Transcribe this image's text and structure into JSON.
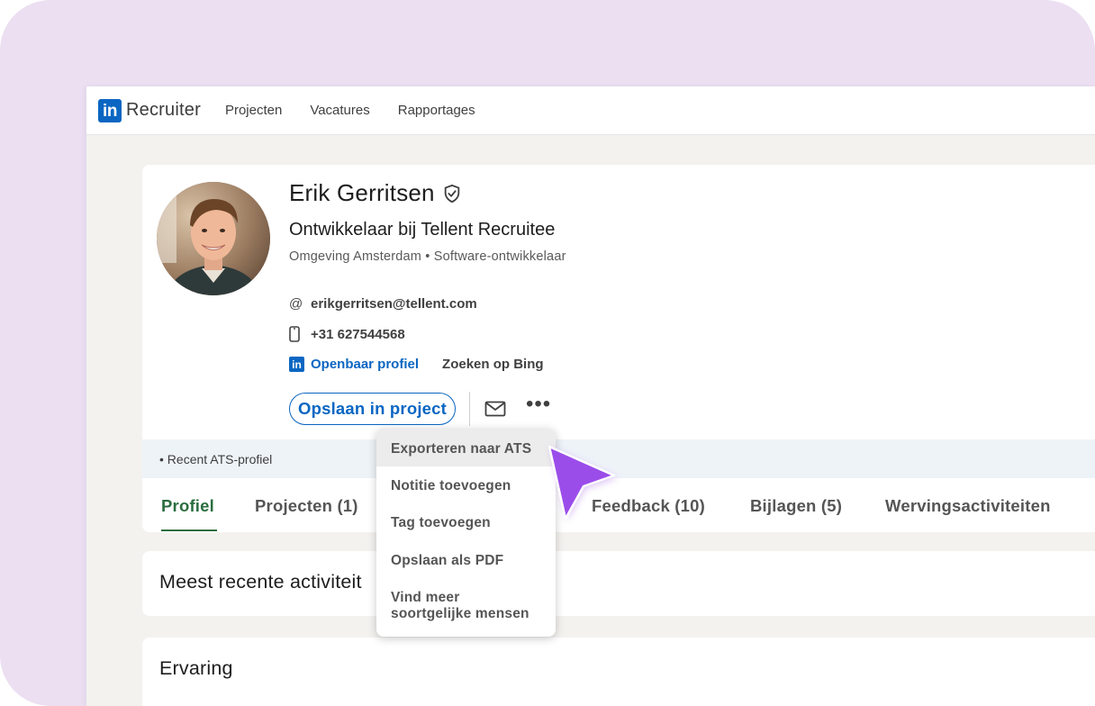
{
  "nav": {
    "logo_badge": "in",
    "brand": "Recruiter",
    "links": [
      "Projecten",
      "Vacatures",
      "Rapportages"
    ]
  },
  "profile": {
    "name": "Erik Gerritsen",
    "headline": "Ontwikkelaar bij Tellent Recruitee",
    "meta": "Omgeving Amsterdam • Software-ontwikkelaar",
    "email_icon": "@",
    "email": "erikgerritsen@tellent.com",
    "phone": "+31 627544568",
    "public_profile_badge": "in",
    "public_profile_link": "Openbaar profiel",
    "bing_link": "Zoeken op Bing",
    "save_button": "Opslaan in project",
    "more_button": "•••",
    "ats_note": "• Recent ATS-profiel"
  },
  "tabs": [
    {
      "label": "Profiel",
      "active": true
    },
    {
      "label": "Projecten (1)",
      "active": false
    },
    {
      "label": "Feedback (10)",
      "active": false
    },
    {
      "label": "Bijlagen (5)",
      "active": false
    },
    {
      "label": "Wervingsactiviteiten",
      "active": false
    }
  ],
  "sections": {
    "activity_title": "Meest recente activiteit",
    "experience_title": "Ervaring"
  },
  "dropdown": {
    "items": [
      {
        "label": "Exporteren naar ATS",
        "highlighted": true
      },
      {
        "label": "Notitie toevoegen",
        "highlighted": false
      },
      {
        "label": "Tag toevoegen",
        "highlighted": false
      },
      {
        "label": "Opslaan als PDF",
        "highlighted": false
      },
      {
        "label": "Vind meer\nsoortgelijke mensen",
        "highlighted": false
      }
    ]
  },
  "colors": {
    "background": "#ecdff2",
    "linkedin_blue": "#0a66c2",
    "active_tab": "#2b6e3f",
    "cursor": "#9b4dea",
    "ats_strip": "#eef3f8"
  },
  "icons": [
    "verified-shield-icon",
    "at-icon",
    "phone-icon",
    "linkedin-icon",
    "mail-icon",
    "more-icon",
    "pointer-cursor-icon"
  ]
}
